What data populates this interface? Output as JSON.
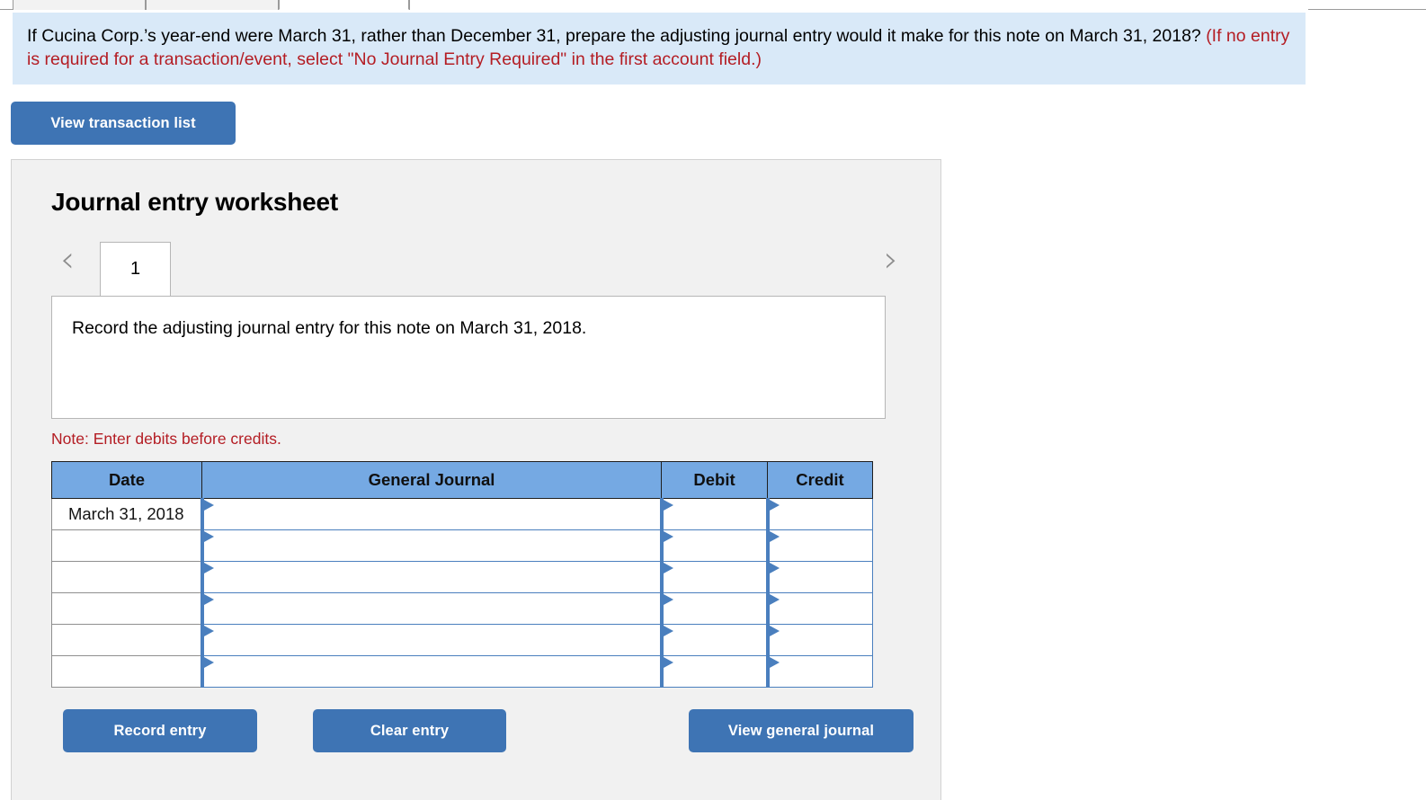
{
  "tabstrip": {
    "tabs": [
      {
        "name": "tab-1",
        "label": ""
      },
      {
        "name": "tab-2",
        "label": ""
      },
      {
        "name": "tab-3-active",
        "label": ""
      },
      {
        "name": "tab-4",
        "label": ""
      }
    ]
  },
  "prompt": {
    "question": "If Cucina Corp.’s year-end were March 31, rather than December 31, prepare the adjusting journal entry would it make for this note on March 31, 2018?",
    "hint": "(If no entry is required for a transaction/event, select \"No Journal Entry Required\" in the first account field.)"
  },
  "toolbar": {
    "view_transaction_list_label": "View transaction list"
  },
  "worksheet": {
    "title": "Journal entry worksheet",
    "pager": {
      "prev_icon": "‹",
      "next_icon": "›",
      "current_tab": "1"
    },
    "scenario_text": "Record the adjusting journal entry for this note on March 31, 2018.",
    "note": "Note: Enter debits before credits.",
    "table": {
      "headers": [
        "Date",
        "General Journal",
        "Debit",
        "Credit"
      ],
      "rows": [
        {
          "date": "March 31, 2018",
          "general_journal": "",
          "debit": "",
          "credit": ""
        },
        {
          "date": "",
          "general_journal": "",
          "debit": "",
          "credit": ""
        },
        {
          "date": "",
          "general_journal": "",
          "debit": "",
          "credit": ""
        },
        {
          "date": "",
          "general_journal": "",
          "debit": "",
          "credit": ""
        },
        {
          "date": "",
          "general_journal": "",
          "debit": "",
          "credit": ""
        },
        {
          "date": "",
          "general_journal": "",
          "debit": "",
          "credit": ""
        }
      ]
    },
    "actions": {
      "record_entry_label": "Record entry",
      "clear_entry_label": "Clear entry",
      "view_general_journal_label": "View general journal"
    }
  },
  "colors": {
    "accent_blue": "#3e74b4",
    "table_header_blue": "#75a9e3",
    "prompt_background": "#d9e9f8",
    "panel_background": "#f1f1f1",
    "alert_red": "#b41d24",
    "select_border_blue": "#4a7fbe"
  }
}
